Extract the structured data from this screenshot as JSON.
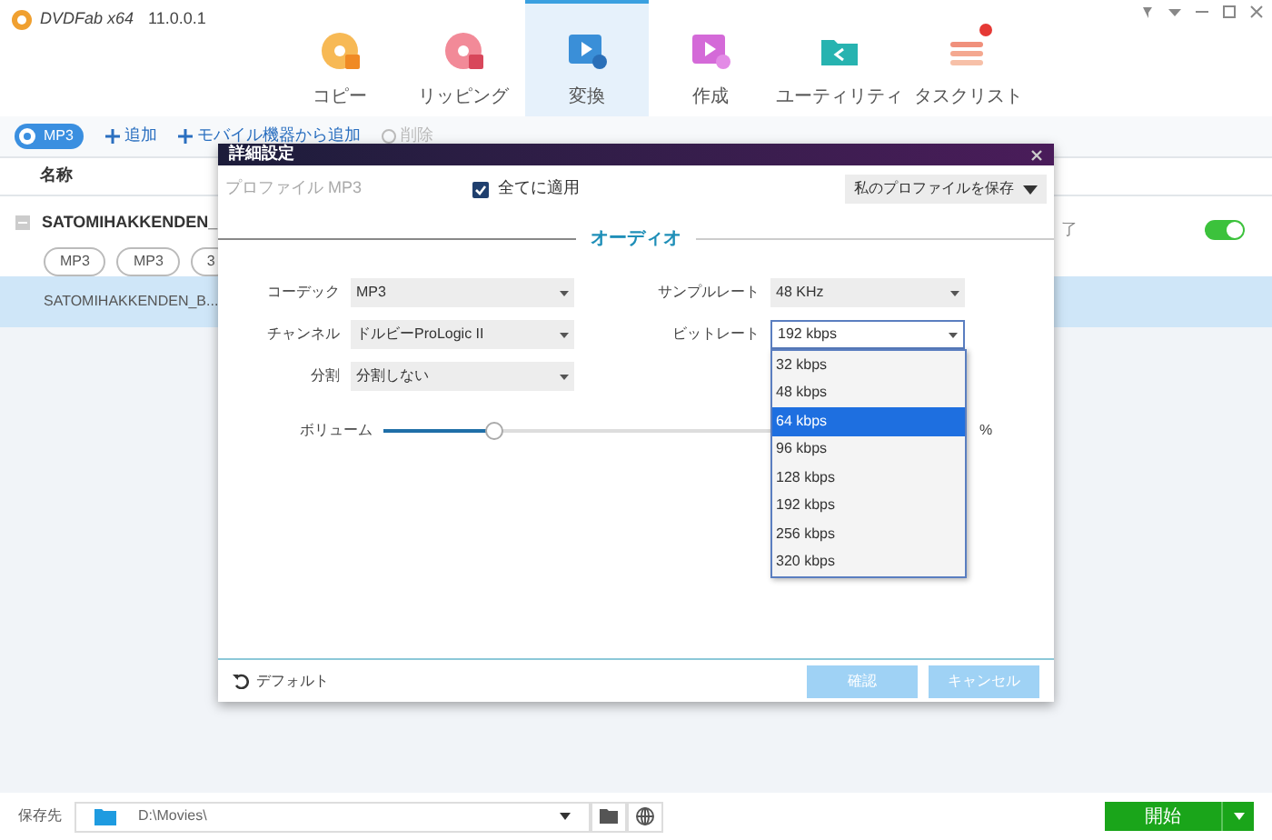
{
  "window": {
    "title": "DVDFab x64",
    "version": "11.0.0.1"
  },
  "nav_tabs": [
    {
      "kind": "copy",
      "label": "コピー",
      "selected": false
    },
    {
      "kind": "ripper",
      "label": "リッピング",
      "selected": false
    },
    {
      "kind": "converter",
      "label": "変換",
      "selected": true
    },
    {
      "kind": "creator",
      "label": "作成",
      "selected": false
    },
    {
      "kind": "utility",
      "label": "ユーティリティ",
      "selected": false
    },
    {
      "kind": "tasks",
      "label": "タスクリスト",
      "selected": false
    }
  ],
  "toolbar": {
    "profile_button": "MP3",
    "actions": [
      {
        "label": "追加",
        "disabled": false
      },
      {
        "label": "モバイル機器から追加",
        "disabled": false
      },
      {
        "label": "削除",
        "disabled": true
      }
    ]
  },
  "file_list": {
    "header": "名称",
    "title": "SATOMIHAKKENDEN_",
    "tags": [
      "MP3",
      "MP3",
      "3"
    ],
    "status": "了",
    "enabled": true,
    "rows": [
      {
        "name": "SATOMIHAKKENDEN_B...",
        "selected": true
      }
    ]
  },
  "dialog": {
    "title": "詳細設定",
    "profile_label": "プロファイル MP3",
    "apply_all": {
      "label": "全てに適用",
      "checked": true
    },
    "save_profile": "私のプロファイルを保存",
    "section": "オーディオ",
    "left_fields": [
      {
        "label": "コーデック",
        "value": "MP3"
      },
      {
        "label": "チャンネル",
        "value": "ドルビーProLogic II"
      },
      {
        "label": "分割",
        "value": "分割しない"
      }
    ],
    "right_fields": [
      {
        "label": "サンプルレート",
        "value": "48 KHz",
        "open": false
      },
      {
        "label": "ビットレート",
        "value": "192 kbps",
        "open": true
      }
    ],
    "bitrate_options": [
      {
        "label": "32 kbps",
        "selected": false
      },
      {
        "label": "48 kbps",
        "selected": false
      },
      {
        "label": "64 kbps",
        "selected": true
      },
      {
        "label": "96 kbps",
        "selected": false
      },
      {
        "label": "128 kbps",
        "selected": false
      },
      {
        "label": "192 kbps",
        "selected": false
      },
      {
        "label": "256 kbps",
        "selected": false
      },
      {
        "label": "320 kbps",
        "selected": false
      }
    ],
    "volume": {
      "label": "ボリューム",
      "level": 0.19,
      "unit": "%"
    },
    "reset": "デフォルト",
    "buttons": [
      "確認",
      "キャンセル"
    ]
  },
  "bottom_bar": {
    "save_label": "保存先",
    "path": "D:\\Movies\\",
    "start": "開始"
  }
}
